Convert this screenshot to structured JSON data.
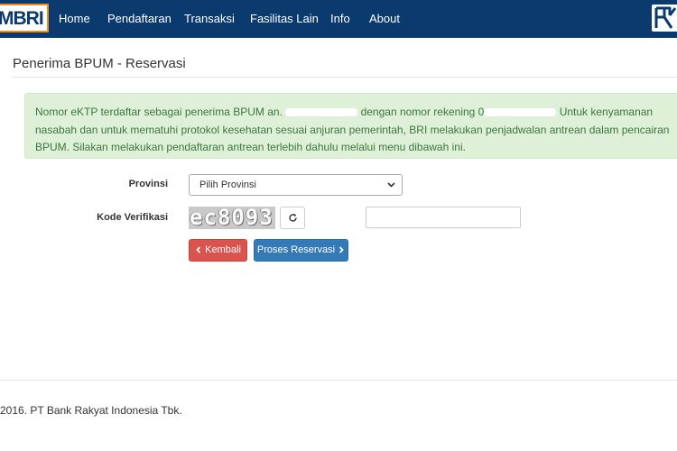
{
  "brand": {
    "logo_text": "MBRI"
  },
  "nav": {
    "items": [
      "Home",
      "Pendaftaran",
      "Transaksi",
      "Fasilitas Lain",
      "Info",
      "About"
    ]
  },
  "page": {
    "title": "Penerima BPUM - Reservasi"
  },
  "alert": {
    "part1": "Nomor eKTP terdaftar sebagai penerima BPUM an. ",
    "part2": " dengan nomor rekening 0",
    "part3": " Untuk kenyamanan nasabah dan untuk mematuhi protokol kesehatan sesuai anjuran pemerintah, BRI melakukan penjadwalan antrean dalam pencairan BPUM. Silakan melakukan pendaftaran antrean terlebih dahulu melalui menu dibawah ini."
  },
  "form": {
    "provinsi_label": "Provinsi",
    "provinsi_value": "Pilih Provinsi",
    "verifikasi_label": "Kode Verifikasi",
    "captcha_text": "ec8093",
    "captcha_input_value": ""
  },
  "buttons": {
    "back_label": "Kembali",
    "submit_label": "Proses Reservasi"
  },
  "footer": {
    "text": "2016. PT Bank Rakyat Indonesia Tbk."
  },
  "colors": {
    "navbar": "#0b3a6e",
    "brand_border": "#f28b20",
    "alert_bg": "#dff0d8",
    "alert_text": "#3c763d",
    "btn_danger": "#d9534f",
    "btn_primary": "#337ab7"
  },
  "icons": [
    "bri-logo-icon",
    "chevron-down-icon",
    "refresh-icon",
    "chevron-left-icon",
    "chevron-right-icon"
  ]
}
